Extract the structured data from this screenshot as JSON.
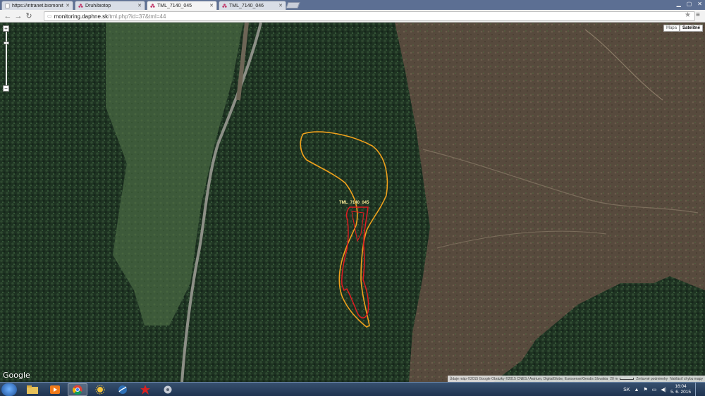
{
  "browser": {
    "tabs": [
      {
        "label": "https://intranet.biomonit"
      },
      {
        "label": "Druh/biotop"
      },
      {
        "label": "TML_7140_045"
      },
      {
        "label": "TML_7140_046"
      }
    ],
    "active_tab": 2,
    "url_host": "monitoring.daphne.sk",
    "url_path": "/tml.php?id=37&tml=44"
  },
  "map": {
    "type_buttons": [
      {
        "label": "Mapa"
      },
      {
        "label": "Satelitné"
      }
    ],
    "selected_type": "Satelitné",
    "polygon_label": "TML_7140_045",
    "polygon_colors": {
      "outer": "#f0a11c",
      "inner": "#e11b22"
    },
    "google_logo": "Google",
    "attribution": "Údaje máp ©2015 Google Obrázky ©2015 CNES / Astrium, DigitalGlobe, Eurosense/Geodis Slovakia",
    "scale_text": "20 m",
    "terms": "Zmluvné podmienky",
    "report": "Nahlásiť chybu mapy"
  },
  "taskbar": {
    "apps": [
      "file-explorer-icon",
      "media-player-icon",
      "chrome-icon",
      "weather-icon",
      "network-icon",
      "red-app-icon",
      "settings-icon"
    ],
    "language": "SK",
    "time": "16:04",
    "date": "5. 6. 2015"
  }
}
